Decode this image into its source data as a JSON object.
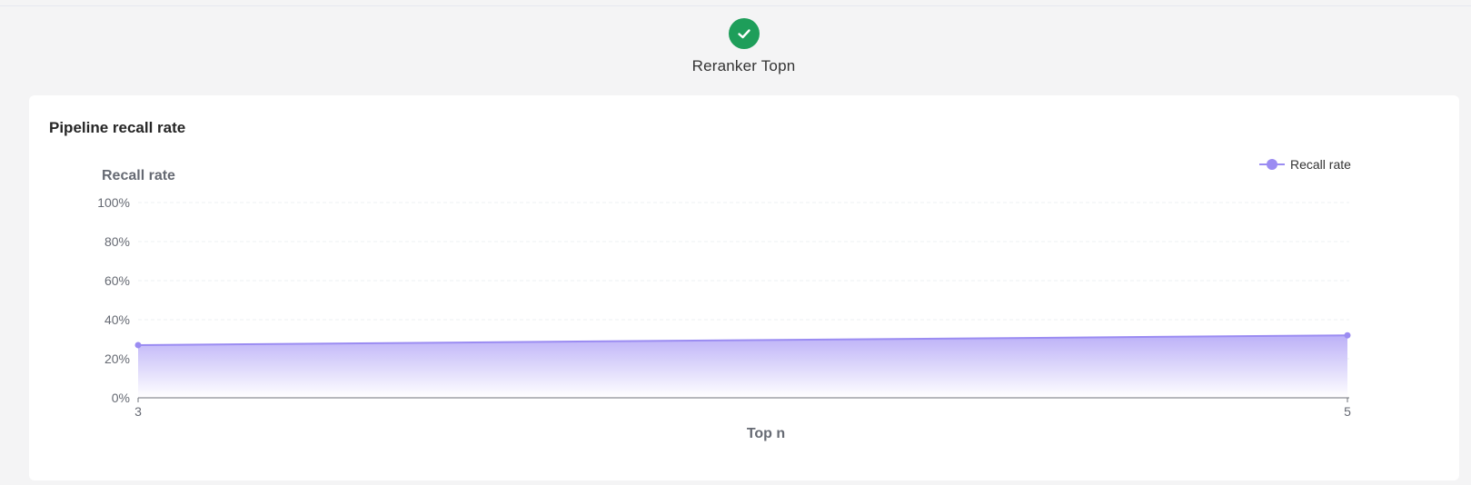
{
  "step": {
    "label": "Reranker Topn",
    "icon": "check-icon",
    "color": "#1e9e5a"
  },
  "card": {
    "title": "Pipeline recall rate"
  },
  "chart_data": {
    "type": "area",
    "title": "Pipeline recall rate",
    "xlabel": "Top n",
    "ylabel": "Recall rate",
    "x": [
      3,
      5
    ],
    "xlim": [
      3,
      5
    ],
    "ylim": [
      0,
      100
    ],
    "yticks": [
      "0%",
      "20%",
      "40%",
      "60%",
      "80%",
      "100%"
    ],
    "xticks": [
      "3",
      "5"
    ],
    "series": [
      {
        "name": "Recall rate",
        "values": [
          27,
          32
        ],
        "color": "#9b8cf2"
      }
    ],
    "legend": "top-right",
    "grid": true
  }
}
